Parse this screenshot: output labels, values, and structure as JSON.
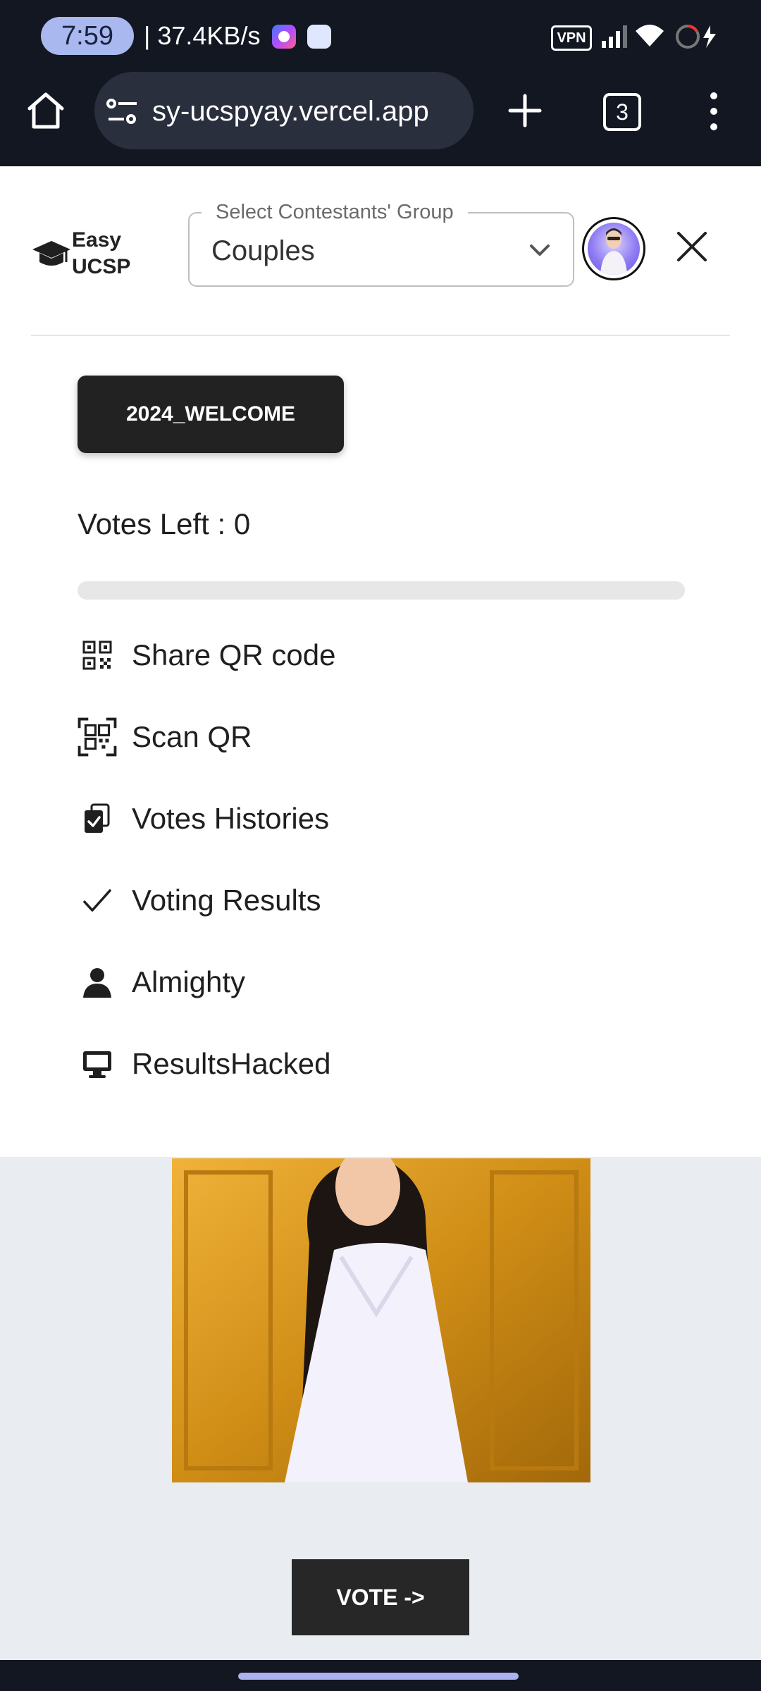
{
  "status_bar": {
    "time": "7:59",
    "net_speed": "| 37.4KB/s",
    "vpn": "VPN"
  },
  "browser": {
    "url": "sy-ucspyay.vercel.app",
    "tab_count": "3"
  },
  "header": {
    "logo_line1": "Easy",
    "logo_line2": "UCSP",
    "group_select": {
      "label": "Select Contestants' Group",
      "value": "Couples"
    }
  },
  "drawer": {
    "promo_code": "2024_WELCOME",
    "votes_left": "Votes Left : 0",
    "votes_progress": 0,
    "menu": [
      {
        "label": "Share QR code",
        "icon": "qr-code-icon"
      },
      {
        "label": "Scan QR",
        "icon": "qr-scan-icon"
      },
      {
        "label": "Votes Histories",
        "icon": "clipboard-check-icon"
      },
      {
        "label": "Voting Results",
        "icon": "check-icon"
      },
      {
        "label": "Almighty",
        "icon": "person-icon"
      },
      {
        "label": "ResultsHacked",
        "icon": "monitor-icon"
      }
    ]
  },
  "page": {
    "vote_button": "VOTE ->"
  }
}
